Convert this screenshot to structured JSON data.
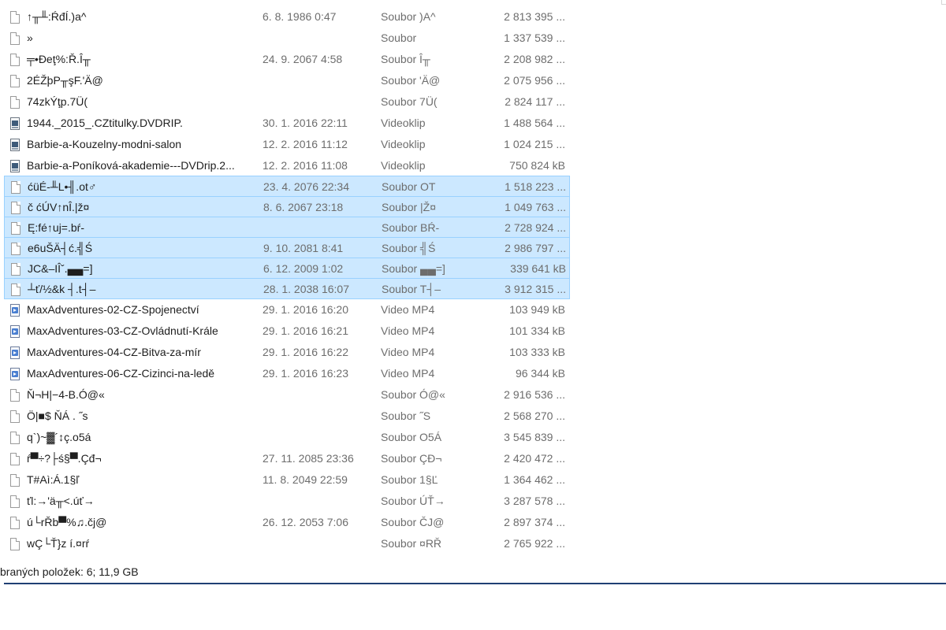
{
  "colors": {
    "selection_bg": "#cce8ff",
    "selection_border": "#99d1ff",
    "secondary_text": "#6d6d6d"
  },
  "files": [
    {
      "icon": "generic-file-icon",
      "name": "↑╥╨:ŔđÍ.)a^",
      "date": "6. 8. 1986 0:47",
      "type": "Soubor )A^",
      "size": "2 813 395 ...",
      "selected": false
    },
    {
      "icon": "generic-file-icon",
      "name": "»",
      "date": "",
      "type": "Soubor",
      "size": "1 337 539 ...",
      "selected": false
    },
    {
      "icon": "generic-file-icon",
      "name": "╤•Đeţ%:Ř.Î╥",
      "date": "24. 9. 2067 4:58",
      "type": "Soubor Î╥",
      "size": "2 208 982 ...",
      "selected": false
    },
    {
      "icon": "generic-file-icon",
      "name": "2ÉŽþP╥şF.'Ä@",
      "date": "",
      "type": "Soubor 'Ä@",
      "size": "2 075 956 ...",
      "selected": false
    },
    {
      "icon": "generic-file-icon",
      "name": "74zkÝţp.7Ü(",
      "date": "",
      "type": "Soubor 7Ü(",
      "size": "2 824 117 ...",
      "selected": false
    },
    {
      "icon": "avi-video-icon",
      "name": "1944._2015_.CZtitulky.DVDRIP.",
      "date": "30. 1. 2016 22:11",
      "type": "Videoklip",
      "size": "1 488 564 ...",
      "selected": false
    },
    {
      "icon": "avi-video-icon",
      "name": "Barbie-a-Kouzelny-modni-salon",
      "date": "12. 2. 2016 11:12",
      "type": "Videoklip",
      "size": "1 024 215 ...",
      "selected": false
    },
    {
      "icon": "avi-video-icon",
      "name": "Barbie-a-Poníková-akademie---DVDrip.2...",
      "date": "12. 2. 2016 11:08",
      "type": "Videoklip",
      "size": "750 824 kB",
      "selected": false
    },
    {
      "icon": "generic-file-icon",
      "name": "ćüÉ-╨L•╢.ot♂",
      "date": "23. 4. 2076 22:34",
      "type": "Soubor OT",
      "size": "1 518 223 ...",
      "selected": true
    },
    {
      "icon": "generic-file-icon",
      "name": "č  ćÚV↑nÎ.|ž¤",
      "date": "8. 6. 2067 23:18",
      "type": "Soubor |Ž¤",
      "size": "1 049 763 ...",
      "selected": true
    },
    {
      "icon": "generic-file-icon",
      "name": "Ę:fé↑uj=.bŕ-",
      "date": "",
      "type": "Soubor BŔ-",
      "size": "2 728 924 ...",
      "selected": true
    },
    {
      "icon": "generic-file-icon",
      "name": "e6uŠÄ┤ć.╣Ś",
      "date": "9. 10. 2081 8:41",
      "type": "Soubor ╣Ś",
      "size": "2 986 797 ...",
      "selected": true
    },
    {
      "icon": "generic-file-icon",
      "name": "JC&–IÎˇ.▄▄=]",
      "date": "6. 12. 2009 1:02",
      "type": "Soubor ▄▄=]",
      "size": "339 641 kB",
      "selected": true
    },
    {
      "icon": "generic-file-icon",
      "name": "┴ť/½&k ┤.t┤–",
      "date": "28. 1. 2038 16:07",
      "type": "Soubor T┤–",
      "size": "3 912 315 ...",
      "selected": true
    },
    {
      "icon": "mp4-video-icon",
      "name": "MaxAdventures-02-CZ-Spojenectví",
      "date": "29. 1. 2016 16:20",
      "type": "Video MP4",
      "size": "103 949 kB",
      "selected": false
    },
    {
      "icon": "mp4-video-icon",
      "name": "MaxAdventures-03-CZ-Ovládnutí-Krále",
      "date": "29. 1. 2016 16:21",
      "type": "Video MP4",
      "size": "101 334 kB",
      "selected": false
    },
    {
      "icon": "mp4-video-icon",
      "name": "MaxAdventures-04-CZ-Bitva-za-mír",
      "date": "29. 1. 2016 16:22",
      "type": "Video MP4",
      "size": "103 333 kB",
      "selected": false
    },
    {
      "icon": "mp4-video-icon",
      "name": "MaxAdventures-06-CZ-Cizinci-na-ledě",
      "date": "29. 1. 2016 16:23",
      "type": "Video MP4",
      "size": "96 344 kB",
      "selected": false
    },
    {
      "icon": "generic-file-icon",
      "name": "Ň¬H|−4-B.Ó@«",
      "date": "",
      "type": "Soubor Ó@«",
      "size": "2 916 536 ...",
      "selected": false
    },
    {
      "icon": "generic-file-icon",
      "name": "Ö|■$ ŇÁ . ˝s",
      "date": "",
      "type": "Soubor  ˝S",
      "size": "2 568 270 ...",
      "selected": false
    },
    {
      "icon": "generic-file-icon",
      "name": "q`)~▓´↕ç.o5á",
      "date": "",
      "type": "Soubor O5Á",
      "size": "3 545 839 ...",
      "selected": false
    },
    {
      "icon": "generic-file-icon",
      "name": "ŕ▀÷?├ś§▀.Çđ¬",
      "date": "27. 11. 2085 23:36",
      "type": "Soubor ÇĐ¬",
      "size": "2 420 472 ...",
      "selected": false
    },
    {
      "icon": "generic-file-icon",
      "name": "T#Aì:Á.1§ľ",
      "date": "11. 8. 2049 22:59",
      "type": "Soubor 1§Ľ",
      "size": "1 364 462 ...",
      "selected": false
    },
    {
      "icon": "generic-file-icon",
      "name": "ťl:→'ä╥<.úť→",
      "date": "",
      "type": "Soubor ÚŤ→",
      "size": "3 287 578 ...",
      "selected": false
    },
    {
      "icon": "generic-file-icon",
      "name": "ú└rŘb▀%♫.čj@",
      "date": "26. 12. 2053 7:06",
      "type": "Soubor ČJ@",
      "size": "2 897 374 ...",
      "selected": false
    },
    {
      "icon": "generic-file-icon",
      "name": "wÇ└Ť}z í.¤rŕ",
      "date": "",
      "type": "Soubor ¤RŘ",
      "size": "2 765 922 ...",
      "selected": false
    }
  ],
  "status_bar": {
    "text": "braných položek: 6; 11,9 GB"
  }
}
